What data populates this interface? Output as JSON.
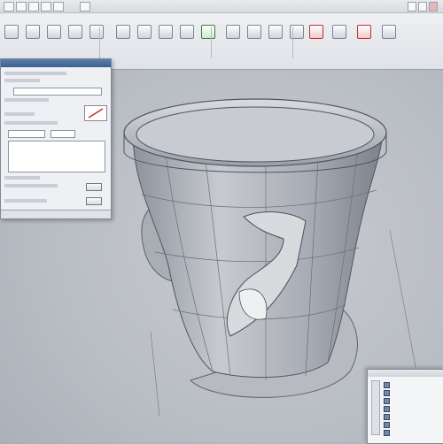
{
  "window": {
    "title": ""
  },
  "ribbon": {
    "tabs": [
      "",
      "",
      "",
      "",
      "",
      ""
    ],
    "buttons": [
      {
        "label": "",
        "icon": "sketch-icon"
      },
      {
        "label": "",
        "icon": "extrude-icon"
      },
      {
        "label": "",
        "icon": "revolve-icon"
      },
      {
        "label": "",
        "icon": "sweep-icon"
      },
      {
        "label": "",
        "icon": "loft-icon"
      },
      {
        "label": "",
        "icon": "fillet-icon"
      },
      {
        "label": "",
        "icon": "chamfer-icon"
      },
      {
        "label": "",
        "icon": "shell-icon"
      },
      {
        "label": "",
        "icon": "rib-icon"
      },
      {
        "label": "",
        "icon": "draft-icon"
      },
      {
        "label": "",
        "icon": "pattern-icon"
      },
      {
        "label": "",
        "icon": "mirror-icon"
      },
      {
        "label": "",
        "icon": "plane-icon"
      },
      {
        "label": "",
        "icon": "axis-icon"
      },
      {
        "label": "",
        "icon": "point-icon"
      },
      {
        "label": "",
        "icon": "measure-icon"
      },
      {
        "label": "",
        "icon": "surface-icon"
      },
      {
        "label": "",
        "icon": "finish-icon"
      }
    ]
  },
  "property_panel": {
    "title": "",
    "ok_label": "",
    "cancel_label": ""
  },
  "feature_manager": {
    "title": "",
    "items": [
      "",
      "",
      "",
      "",
      "",
      "",
      ""
    ]
  },
  "logo_text": "",
  "colors": {
    "accent": "#3d5f8f",
    "selection": "#c0302f",
    "background": "#bcc0c7"
  }
}
